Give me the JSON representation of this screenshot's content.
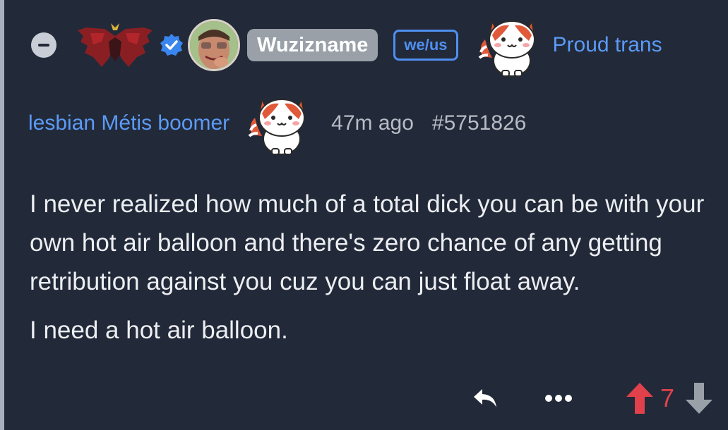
{
  "post": {
    "author": {
      "username": "Wuzizname",
      "pronouns": "we/us",
      "flair_text": "Proud trans",
      "identity": "lesbian Métis boomer"
    },
    "timestamp": "47m ago",
    "post_id": "#5751826",
    "body": [
      "I never realized how much of a total dick you can be with your own hot air balloon and there's zero chance of any getting retribution against you cuz you can just float away.",
      "I need a hot air balloon."
    ],
    "score": "7"
  },
  "icons": {
    "collapse": "minus-circle-icon",
    "flair": "bat-wings-crown-icon",
    "verified": "verified-badge-icon",
    "cat": "red-panda-cat-sticker",
    "reply": "reply-arrow-icon",
    "more": "ellipsis-icon",
    "upvote": "upvote-arrow-icon",
    "downvote": "downvote-arrow-icon"
  },
  "colors": {
    "background": "#222939",
    "accent_blue": "#5b9bf5",
    "upvote_red": "#e0414a",
    "muted": "#b8bcc5"
  }
}
